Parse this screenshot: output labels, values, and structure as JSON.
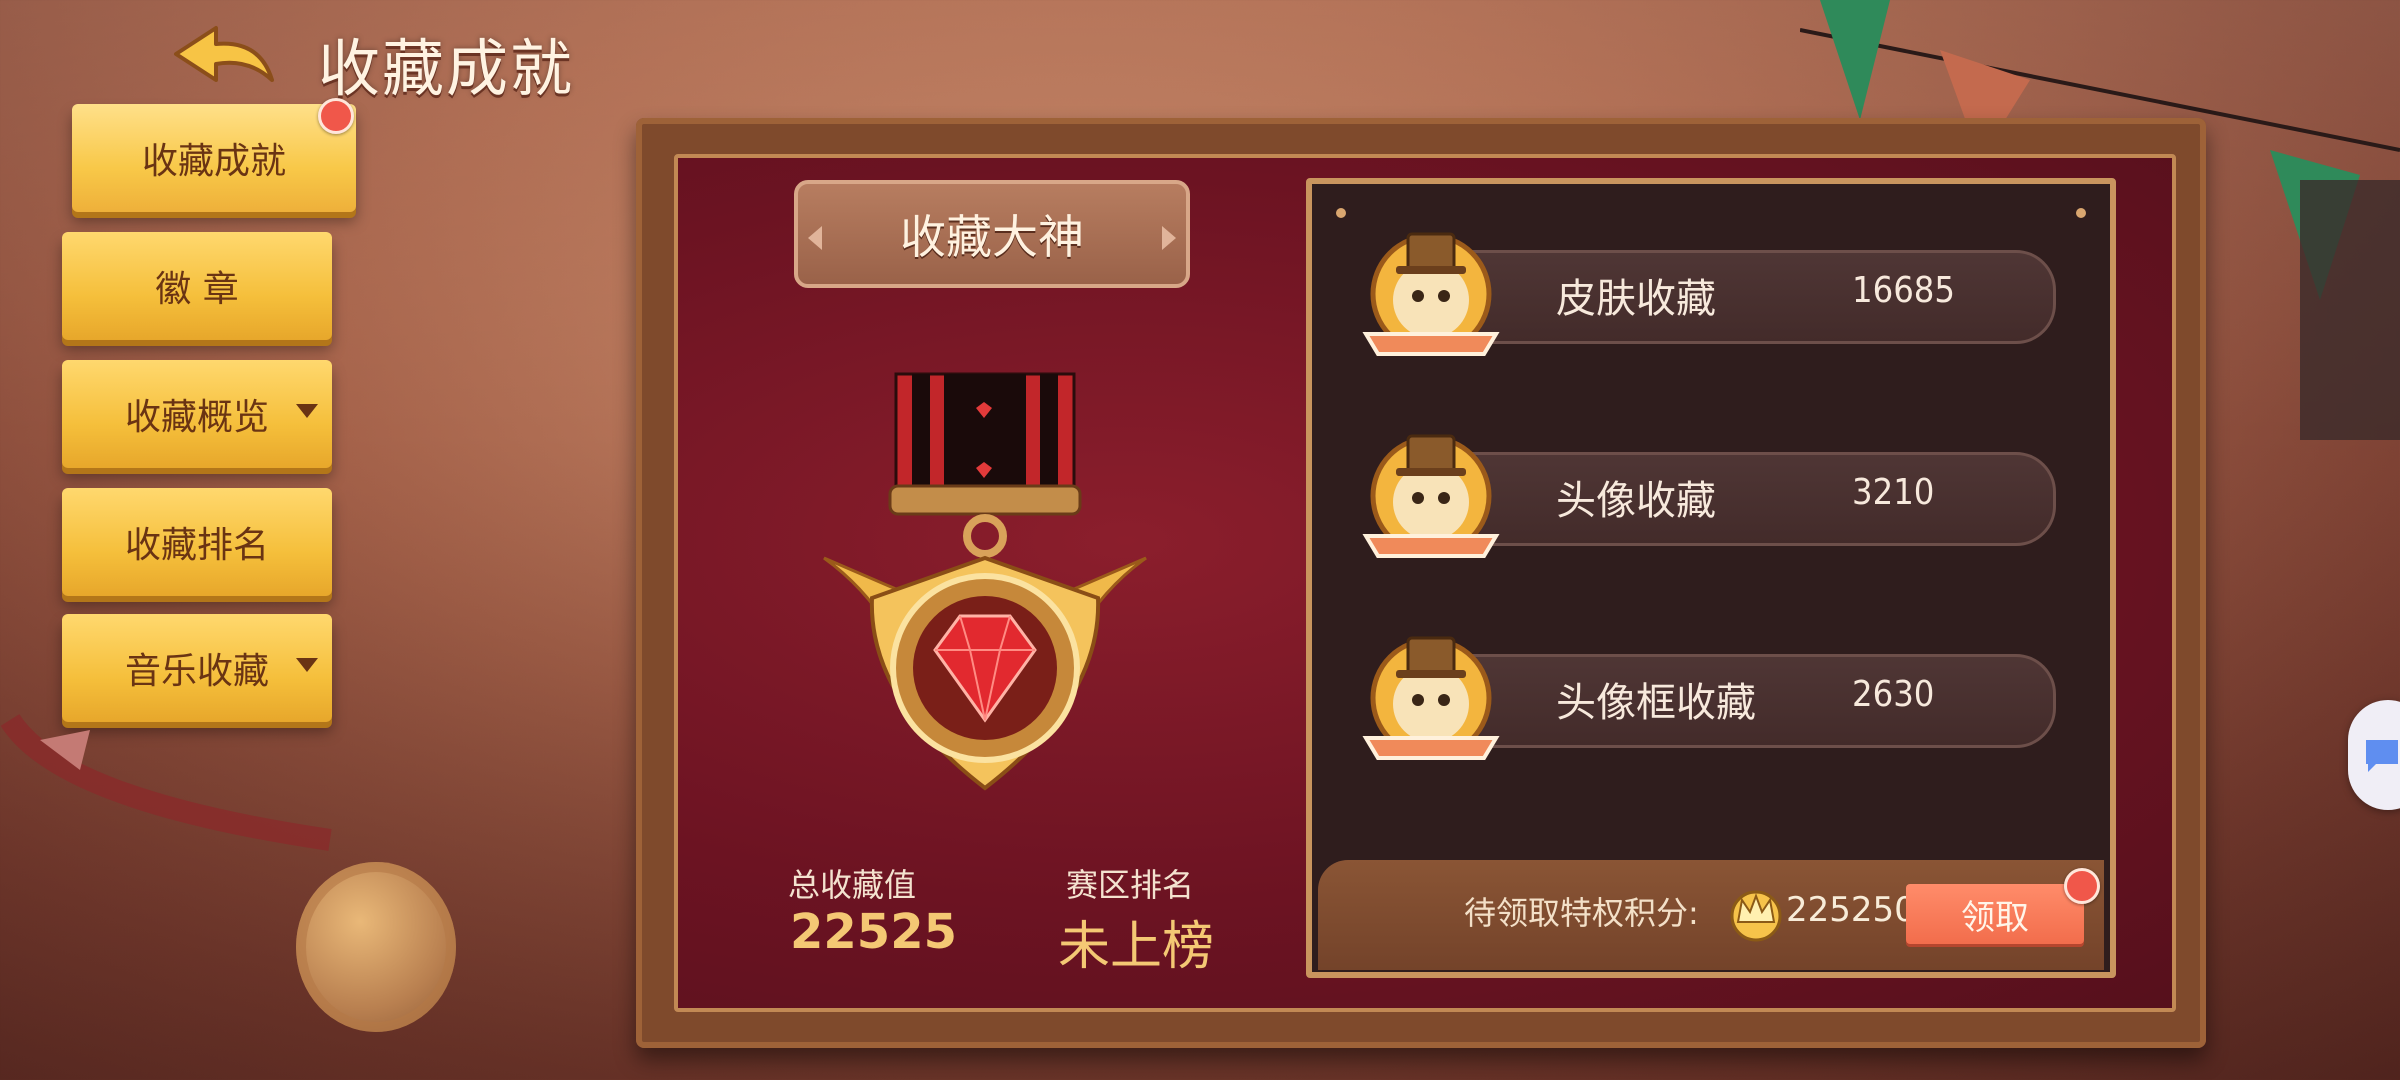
{
  "header": {
    "title": "收藏成就",
    "back_icon": "back-arrow-icon"
  },
  "sidebar": {
    "tabs": [
      {
        "label": "收藏成就",
        "active": true,
        "has_dot": true
      },
      {
        "label": "徽 章"
      },
      {
        "label": "收藏概览",
        "has_dropdown": true
      },
      {
        "label": "收藏排名"
      },
      {
        "label": "音乐收藏",
        "has_dropdown": true
      }
    ]
  },
  "main": {
    "achievement_title": "收藏大神",
    "total": {
      "label": "总收藏值",
      "value": "22525"
    },
    "rank": {
      "label": "赛区排名",
      "value": "未上榜"
    }
  },
  "collections": [
    {
      "label": "皮肤收藏",
      "value": "16685"
    },
    {
      "label": "头像收藏",
      "value": "3210"
    },
    {
      "label": "头像框收藏",
      "value": "2630"
    }
  ],
  "claim": {
    "label": "待领取特权积分:",
    "points": "225250",
    "button": "领取"
  },
  "colors": {
    "accent": "#f5bf3b",
    "claim_button": "#f26d4c",
    "board": "#6c1322"
  }
}
